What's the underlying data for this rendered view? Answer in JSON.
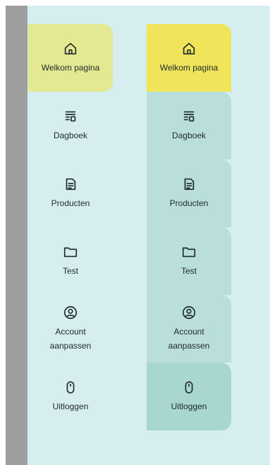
{
  "menu_left": {
    "items": [
      {
        "label": "Welkom pagina",
        "icon": "home-icon"
      },
      {
        "label": "Dagboek",
        "icon": "journal-icon"
      },
      {
        "label": "Producten",
        "icon": "document-icon"
      },
      {
        "label": "Test",
        "icon": "folder-icon"
      },
      {
        "label": "Account aanpassen",
        "icon": "user-circle-icon"
      },
      {
        "label": "Uitloggen",
        "icon": "mouse-icon"
      }
    ]
  },
  "menu_right": {
    "items": [
      {
        "label": "Welkom pagina",
        "icon": "home-icon"
      },
      {
        "label": "Dagboek",
        "icon": "journal-icon"
      },
      {
        "label": "Producten",
        "icon": "document-icon"
      },
      {
        "label": "Test",
        "icon": "folder-icon"
      },
      {
        "label": "Account aanpassen",
        "icon": "user-circle-icon"
      },
      {
        "label": "Uitloggen",
        "icon": "mouse-icon"
      }
    ]
  },
  "colors": {
    "panel": "#d6eef0",
    "left_active": "#e4e991",
    "right_active": "#f0e45a",
    "right_inactive": "#b9dedc",
    "right_logout": "#a8d6d0",
    "grey_bar": "#9e9e9e"
  }
}
